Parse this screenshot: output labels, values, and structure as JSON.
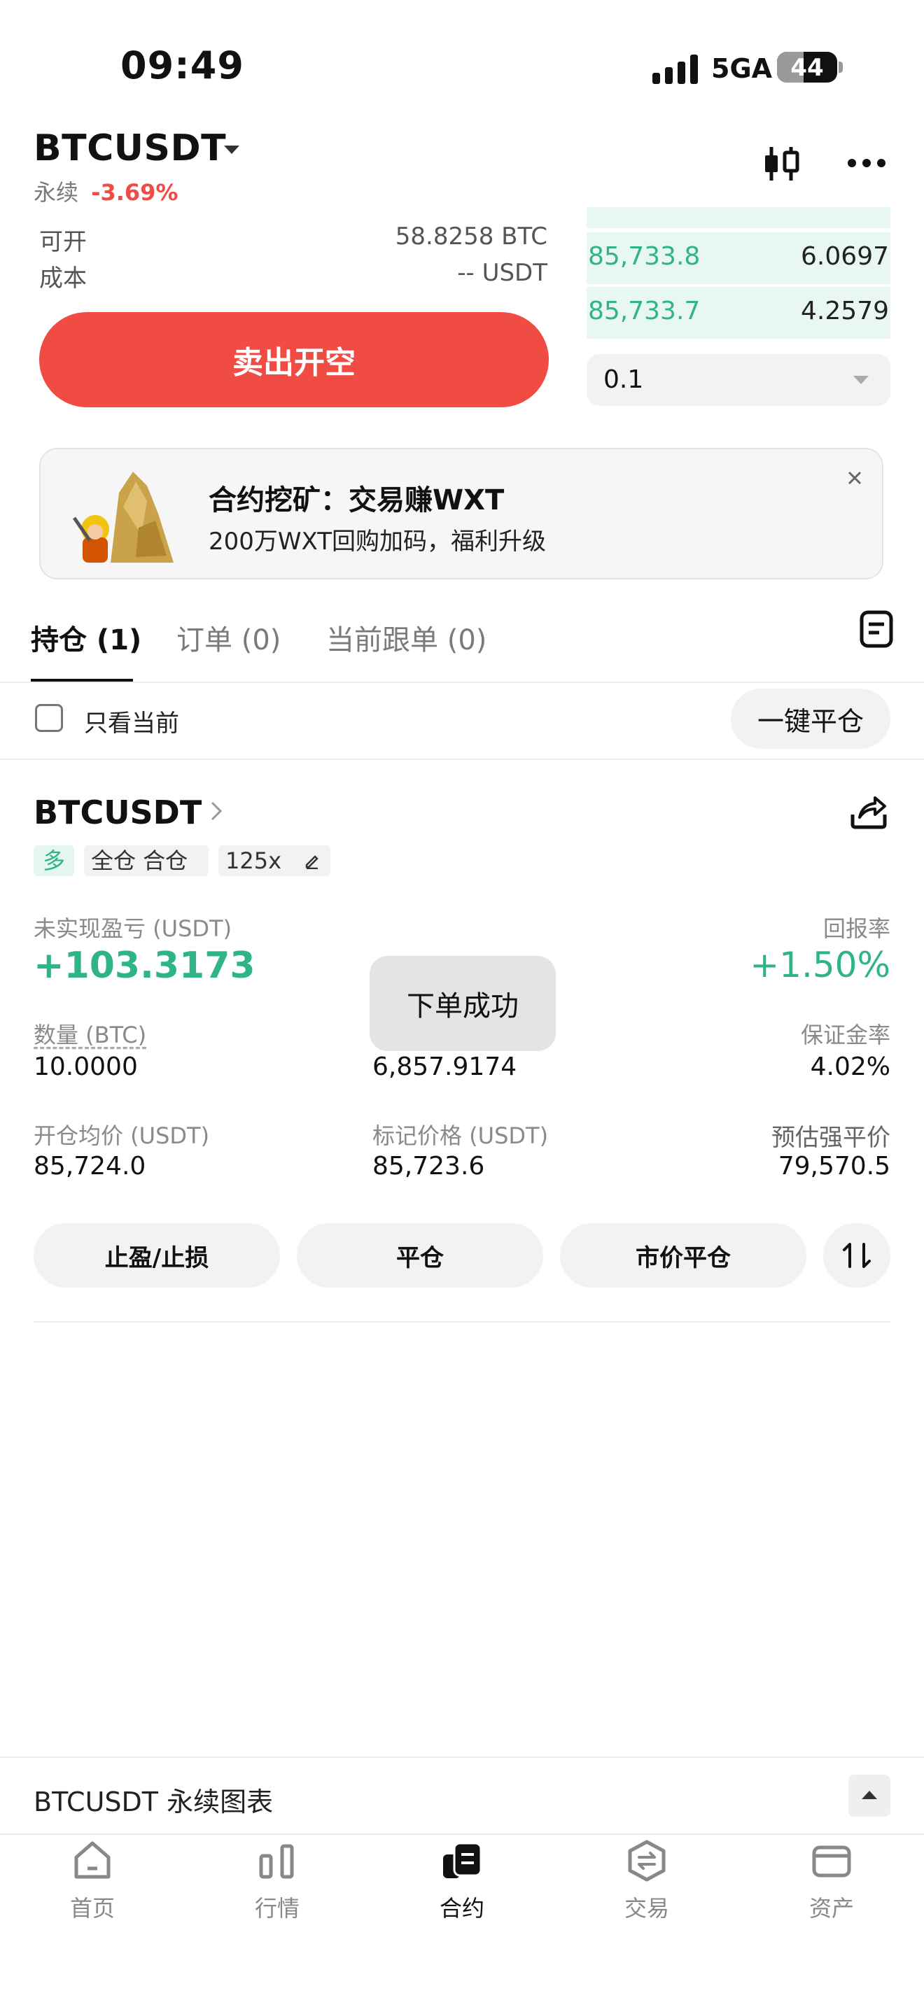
{
  "status_bar": {
    "time": "09:49",
    "network": "5GA",
    "battery": "44"
  },
  "header": {
    "pair": "BTCUSDT",
    "type": "永续",
    "change": "-3.69%"
  },
  "order_panel": {
    "available_label": "可开",
    "available_value": "58.8258 BTC",
    "cost_label": "成本",
    "cost_value": "-- USDT",
    "sell_button": "卖出开空"
  },
  "order_book": {
    "rows": [
      {
        "price": "85,733.8",
        "qty": "6.0697"
      },
      {
        "price": "85,733.7",
        "qty": "4.2579"
      }
    ],
    "depth_select": "0.1"
  },
  "banner": {
    "title": "合约挖矿：交易赚WXT",
    "subtitle": "200万WXT回购加码，福利升级"
  },
  "tabs": {
    "positions": "持仓 (1)",
    "orders": "订单 (0)",
    "copy": "当前跟单 (0)"
  },
  "filter": {
    "only_current": "只看当前",
    "close_all": "一键平仓"
  },
  "position": {
    "symbol": "BTCUSDT",
    "tags": {
      "side": "多",
      "margin": "全仓 合仓",
      "leverage": "125x"
    },
    "pnl_label": "未实现盈亏 (USDT)",
    "pnl_value": "+103.3173",
    "roe_label": "回报率",
    "roe_value": "+1.50%",
    "qty_label": "数量 (BTC)",
    "qty_value": "10.0000",
    "margin_value": "6,857.9174",
    "margin_rate_label": "保证金率",
    "margin_rate_value": "4.02%",
    "entry_label": "开仓均价 (USDT)",
    "entry_value": "85,724.0",
    "mark_label": "标记价格 (USDT)",
    "mark_value": "85,723.6",
    "liq_label": "预估强平价",
    "liq_value": "79,570.5",
    "toast": "下单成功"
  },
  "actions": {
    "tpsl": "止盈/止损",
    "close": "平仓",
    "market_close": "市价平仓"
  },
  "chart_bar": {
    "label": "BTCUSDT 永续图表"
  },
  "nav": {
    "home": "首页",
    "market": "行情",
    "futures": "合约",
    "trade": "交易",
    "assets": "资产"
  },
  "colors": {
    "green": "#2fb487",
    "red": "#ee4c45",
    "sell_button": "#f14c43"
  }
}
